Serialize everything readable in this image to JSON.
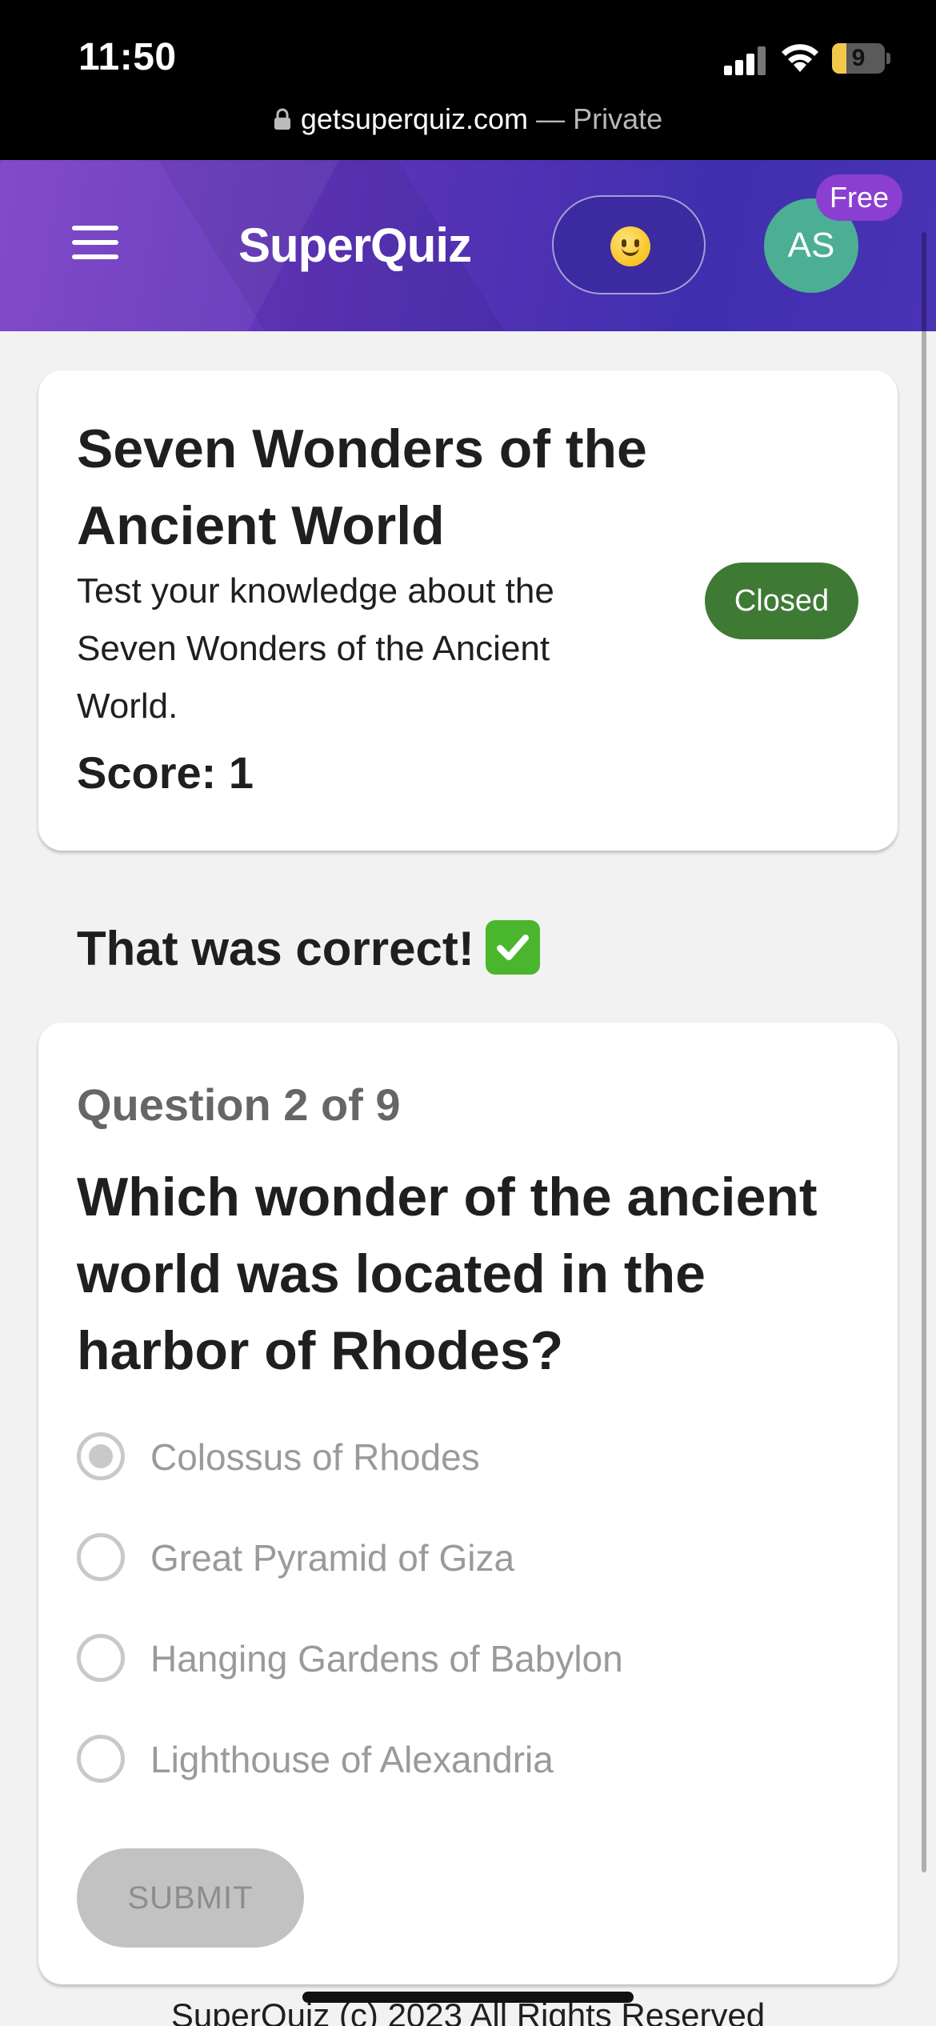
{
  "status_bar": {
    "time": "11:50",
    "battery_level": "9",
    "url": "getsuperquiz.com",
    "url_suffix": "— Private"
  },
  "header": {
    "logo": "SuperQuiz",
    "mood_icon": "slightly-smiling-face-icon",
    "avatar_initials": "AS",
    "plan_badge": "Free"
  },
  "quiz": {
    "title": "Seven Wonders of the Ancient World",
    "description": "Test your knowledge about the Seven Wonders of the Ancient World.",
    "status": "Closed",
    "score_text": "Score: 1"
  },
  "feedback": {
    "text": "That was correct!"
  },
  "question": {
    "progress": "Question 2 of 9",
    "text": "Which wonder of the ancient world was located in the harbor of Rhodes?",
    "options": [
      {
        "label": "Colossus of Rhodes",
        "selected": true
      },
      {
        "label": "Great Pyramid of Giza",
        "selected": false
      },
      {
        "label": "Hanging Gardens of Babylon",
        "selected": false
      },
      {
        "label": "Lighthouse of Alexandria",
        "selected": false
      }
    ],
    "submit_label": "SUBMIT"
  },
  "footer": {
    "text": "SuperQuiz (c) 2023 All Rights Reserved"
  },
  "colors": {
    "header_gradient_start": "#7b3fc6",
    "header_gradient_end": "#3f2fae",
    "status_closed": "#3f7a35",
    "avatar": "#4caf93",
    "plan_badge": "#8a3fd1",
    "correct_check": "#4ab62e"
  }
}
